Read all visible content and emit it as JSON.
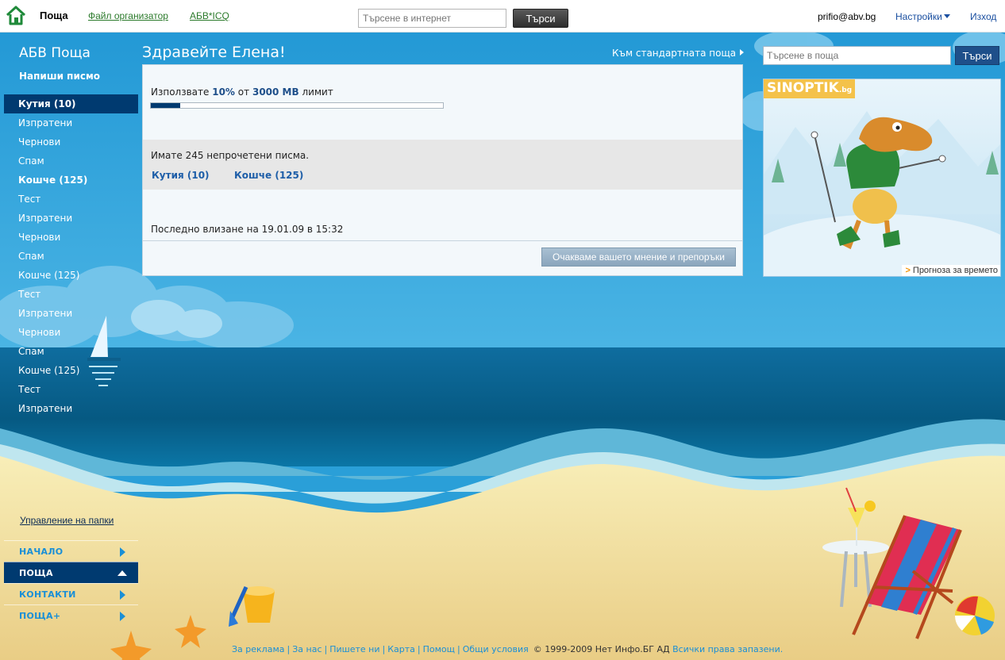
{
  "topbar": {
    "mail": "Поща",
    "files": "Файл организатор",
    "icq": "АБВ*ICQ",
    "search_placeholder": "Търсене в интернет",
    "search_button": "Търси",
    "email": "prifio@abv.bg",
    "settings": "Настройки",
    "logout": "Изход"
  },
  "sidebar": {
    "brand": "АБВ Поща",
    "compose": "Напиши писмо",
    "folders": [
      {
        "label": "Кутия (10)",
        "style": "active"
      },
      {
        "label": "Изпратени",
        "style": ""
      },
      {
        "label": "Чернови",
        "style": ""
      },
      {
        "label": "Спам",
        "style": ""
      },
      {
        "label": "Кошче (125)",
        "style": "bold"
      },
      {
        "label": "Тест",
        "style": ""
      },
      {
        "label": "Изпратени",
        "style": ""
      },
      {
        "label": "Чернови",
        "style": ""
      },
      {
        "label": "Спам",
        "style": ""
      },
      {
        "label": "Кошче (125)",
        "style": ""
      },
      {
        "label": "Тест",
        "style": ""
      },
      {
        "label": "Изпратени",
        "style": ""
      },
      {
        "label": "Чернови",
        "style": ""
      },
      {
        "label": "Спам",
        "style": ""
      },
      {
        "label": "Кошче (125)",
        "style": ""
      },
      {
        "label": "Тест",
        "style": ""
      },
      {
        "label": "Изпратени",
        "style": ""
      }
    ],
    "manage_folders": "Управление на папки",
    "nav": [
      {
        "label": "НАЧАЛО",
        "active": false
      },
      {
        "label": "ПОЩА",
        "active": true
      },
      {
        "label": "КОНТАКТИ",
        "active": false
      },
      {
        "label": "ПОЩА+",
        "active": false
      }
    ]
  },
  "main": {
    "greeting": "Здравейте Елена!",
    "classic_link": "Към стандартната поща",
    "quota": {
      "prefix": "Използвате",
      "percent": "10%",
      "middle": "от",
      "limit": "3000 MB",
      "suffix": "лимит",
      "fraction": 0.1
    },
    "unread_text": "Имате 245 непрочетени писма.",
    "unread_inbox": "Кутия (10)",
    "unread_trash": "Кошче (125)",
    "last_login": "Последно влизане на 19.01.09 в 15:32",
    "feedback_button": "Очакваме вашето мнение и препоръки"
  },
  "right": {
    "search_placeholder": "Търсене в поща",
    "search_button": "Търси",
    "weather_logo": "SINOPTIK",
    "weather_logo_suffix": ".bg",
    "weather_caption": "Прогноза за времето",
    "caption_marker": ">"
  },
  "footer": {
    "links": [
      "За реклама",
      "За нас",
      "Пишете ни",
      "Карта",
      "Помощ",
      "Общи условия"
    ],
    "copyright": "© 1999-2009 Нет Инфо.БГ АД",
    "rights": "Всички права запазени."
  },
  "colors": {
    "sky": "#2a9fd8",
    "active_item": "#003a70",
    "link_green": "#2b7a2b",
    "link_blue": "#1a8fd6"
  }
}
